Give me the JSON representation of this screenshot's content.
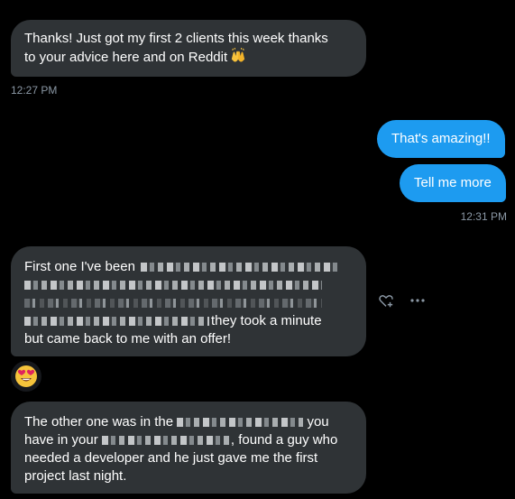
{
  "messages": {
    "m1": {
      "line1": "Thanks! Just got my first 2 clients this week thanks",
      "line2": "to your advice here and on Reddit",
      "emoji": "raising-hands-icon"
    },
    "m1_time": "12:27 PM",
    "m2": {
      "text": "That's amazing!!"
    },
    "m3": {
      "text": "Tell me more"
    },
    "m3_time": "12:31 PM",
    "m4": {
      "line1": "First one I've been",
      "line3_tail": "they took a minute",
      "line4": "but came back to me with an offer!"
    },
    "m4_reaction": "heart-eyes-emoji-icon",
    "m5": {
      "line1_a": "The other one was in the",
      "line1_b": "you",
      "line2_a": "have in your",
      "line2_b": ", found a guy who",
      "line3": "needed a developer and he just gave me the first",
      "line4": "project last night."
    }
  },
  "actions": {
    "react_icon": "heart-plus-icon",
    "more_icon": "more-horizontal-icon"
  },
  "colors": {
    "background": "#000000",
    "incoming_bubble": "#2f3336",
    "outgoing_bubble": "#1d9bf0",
    "timestamp": "#8b98a5"
  }
}
